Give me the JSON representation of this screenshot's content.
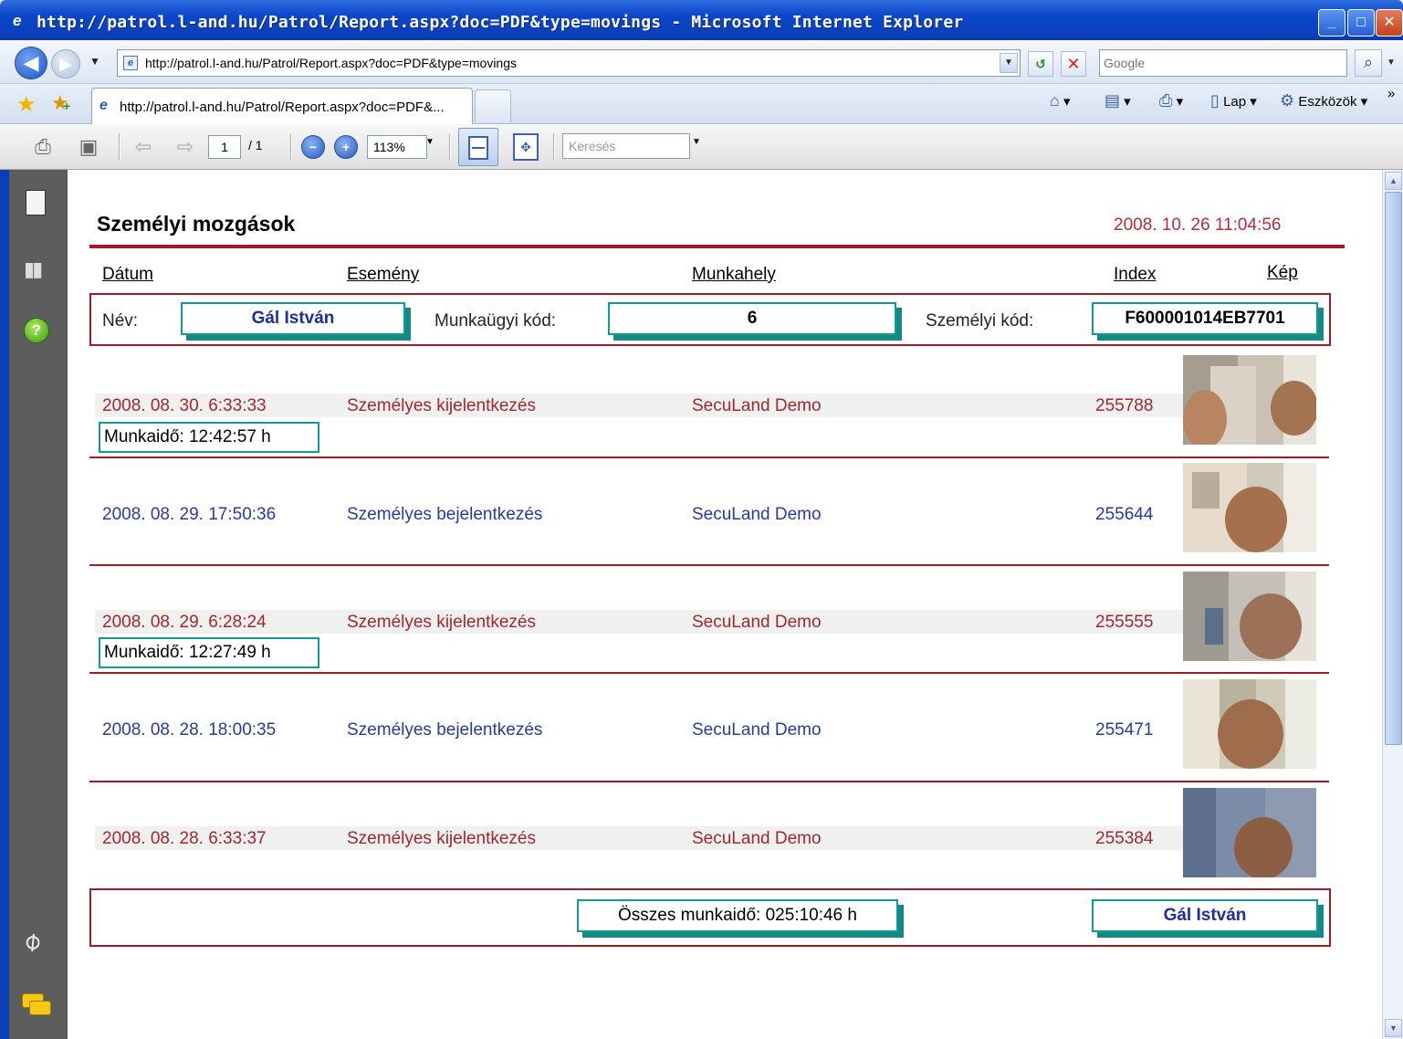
{
  "window": {
    "title": "http://patrol.l-and.hu/Patrol/Report.aspx?doc=PDF&type=movings - Microsoft Internet Explorer",
    "minimize": "_",
    "maximize": "□",
    "close": "✕"
  },
  "address": {
    "url": "http://patrol.l-and.hu/Patrol/Report.aspx?doc=PDF&type=movings",
    "search_placeholder": "Google"
  },
  "tabs": {
    "active_label": "http://patrol.l-and.hu/Patrol/Report.aspx?doc=PDF&..."
  },
  "commandbar": {
    "page_label": "Lap",
    "tools_label": "Eszközök",
    "more": "»"
  },
  "pdf_toolbar": {
    "page_current": "1",
    "page_total": "/ 1",
    "zoom": "113%",
    "find_placeholder": "Keresés"
  },
  "report": {
    "title": "Személyi mozgások",
    "generated": "2008. 10. 26  11:04:56",
    "columns": {
      "date": "Dátum",
      "event": "Esemény",
      "workplace": "Munkahely",
      "index": "Index",
      "image": "Kép"
    },
    "person": {
      "name_label": "Név:",
      "name": "Gál István",
      "workcode_label": "Munkaügyi kód:",
      "workcode": "6",
      "personal_code_label": "Személyi kód:",
      "personal_code": "F600001014EB7701"
    },
    "rows": [
      {
        "date": "2008. 08. 30.   6:33:33",
        "event": "Személyes kijelentkezés",
        "workplace": "SecuLand Demo",
        "index": "255788",
        "worktime": "Munkaidő: 12:42:57 h"
      },
      {
        "date": "2008. 08. 29.  17:50:36",
        "event": "Személyes bejelentkezés",
        "workplace": "SecuLand Demo",
        "index": "255644"
      },
      {
        "date": "2008. 08. 29.   6:28:24",
        "event": "Személyes kijelentkezés",
        "workplace": "SecuLand Demo",
        "index": "255555",
        "worktime": "Munkaidő: 12:27:49 h"
      },
      {
        "date": "2008. 08. 28.  18:00:35",
        "event": "Személyes bejelentkezés",
        "workplace": "SecuLand Demo",
        "index": "255471"
      },
      {
        "date": "2008. 08. 28.   6:33:37",
        "event": "Személyes kijelentkezés",
        "workplace": "SecuLand Demo",
        "index": "255384"
      }
    ],
    "footer": {
      "total": "Összes munkaidő: 025:10:46 h",
      "name": "Gál István"
    }
  },
  "colors": {
    "accent_red": "#a01c24",
    "teal": "#119a96",
    "login_blue": "#2a3a9c",
    "logout_red": "#a02830"
  }
}
